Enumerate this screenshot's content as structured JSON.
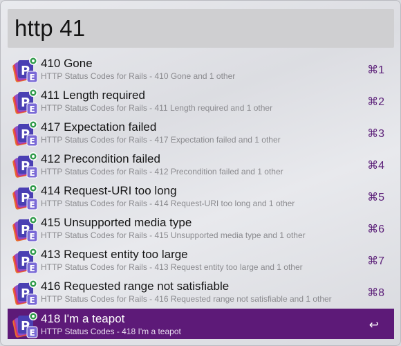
{
  "search": {
    "query": "http 41"
  },
  "results": [
    {
      "title": "410 Gone",
      "subtitle": "HTTP Status Codes for Rails - 410 Gone and 1 other",
      "shortcut": "⌘1"
    },
    {
      "title": "411 Length required",
      "subtitle": "HTTP Status Codes for Rails - 411 Length required and 1 other",
      "shortcut": "⌘2"
    },
    {
      "title": "417 Expectation failed",
      "subtitle": "HTTP Status Codes for Rails - 417 Expectation failed and 1 other",
      "shortcut": "⌘3"
    },
    {
      "title": "412 Precondition failed",
      "subtitle": "HTTP Status Codes for Rails - 412 Precondition failed and 1 other",
      "shortcut": "⌘4"
    },
    {
      "title": "414 Request-URI too long",
      "subtitle": "HTTP Status Codes for Rails - 414 Request-URI too long and 1 other",
      "shortcut": "⌘5"
    },
    {
      "title": "415 Unsupported media type",
      "subtitle": "HTTP Status Codes for Rails - 415 Unsupported media type and 1 other",
      "shortcut": "⌘6"
    },
    {
      "title": "413 Request entity too large",
      "subtitle": "HTTP Status Codes for Rails - 413 Request entity too large and 1 other",
      "shortcut": "⌘7"
    },
    {
      "title": "416 Requested range not satisfiable",
      "subtitle": "HTTP Status Codes for Rails - 416 Requested range not satisfiable and 1 other",
      "shortcut": "⌘8"
    },
    {
      "title": "418 I'm a teapot",
      "subtitle": "HTTP Status Codes - 418 I'm a teapot",
      "shortcut": "↩",
      "selected": true
    }
  ],
  "icon": {
    "name": "dash-docset-icon",
    "accent": "#5d1a78"
  }
}
